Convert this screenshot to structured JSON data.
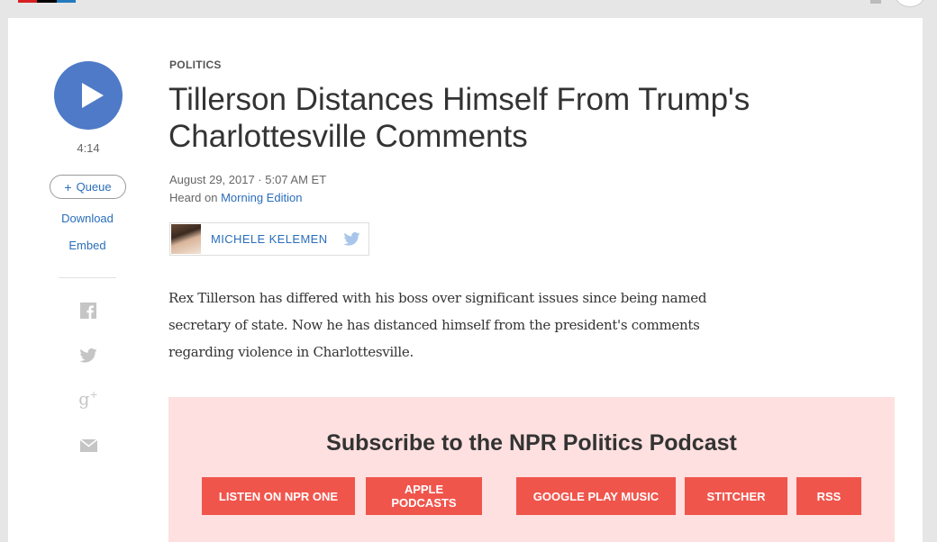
{
  "colors": {
    "accent_blue": "#2a6ebb",
    "play_blue": "#4e7ac7",
    "promo_bg": "#fde0df",
    "promo_button": "#f0554c"
  },
  "player": {
    "play_icon": "play-icon",
    "duration": "4:14",
    "queue_icon": "plus-icon",
    "queue_label": "Queue",
    "download_label": "Download",
    "embed_label": "Embed"
  },
  "share": {
    "icons": [
      "facebook-icon",
      "twitter-icon",
      "google-plus-icon",
      "email-icon"
    ]
  },
  "article": {
    "kicker": "POLITICS",
    "title": "Tillerson Distances Himself From Trump's Charlottesville Comments",
    "dateline": "August 29, 2017 · 5:07 AM ET",
    "heard_prefix": "Heard on ",
    "program": "Morning Edition",
    "author": "MICHELE KELEMEN",
    "teaser": "Rex Tillerson has differed with his boss over significant issues since being named secretary of state. Now he has distanced himself from the president's comments regarding violence in Charlottesville."
  },
  "promo": {
    "title": "Subscribe to the NPR Politics Podcast",
    "buttons": {
      "npr_one": "LISTEN ON NPR ONE",
      "apple": "APPLE PODCASTS",
      "google": "GOOGLE PLAY MUSIC",
      "stitcher": "STITCHER",
      "rss": "RSS"
    }
  }
}
